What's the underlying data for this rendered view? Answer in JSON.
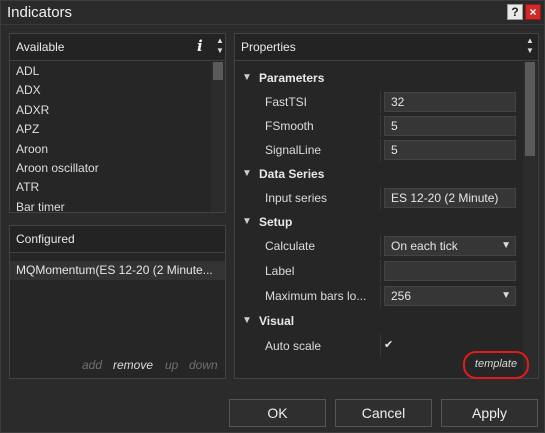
{
  "window": {
    "title": "Indicators",
    "help_label": "?",
    "close_label": "×"
  },
  "available": {
    "title": "Available",
    "info_label": "i",
    "items": [
      "ADL",
      "ADX",
      "ADXR",
      "APZ",
      "Aroon",
      "Aroon oscillator",
      "ATR",
      "Bar timer"
    ]
  },
  "configured": {
    "title": "Configured",
    "item": "MQMomentum(ES 12-20 (2 Minute...",
    "actions": {
      "add": "add",
      "remove": "remove",
      "up": "up",
      "down": "down"
    }
  },
  "properties": {
    "title": "Properties",
    "parameters": {
      "label": "Parameters",
      "fast_tsi": {
        "label": "FastTSI",
        "value": "32"
      },
      "fsmooth": {
        "label": "FSmooth",
        "value": "5"
      },
      "signal_line": {
        "label": "SignalLine",
        "value": "5"
      }
    },
    "data_series": {
      "label": "Data Series",
      "input_series": {
        "label": "Input series",
        "value": "ES 12-20 (2 Minute)"
      }
    },
    "setup": {
      "label": "Setup",
      "calculate": {
        "label": "Calculate",
        "value": "On each tick"
      },
      "label_field": {
        "label": "Label",
        "value": ""
      },
      "max_bars": {
        "label": "Maximum bars lo...",
        "value": "256"
      }
    },
    "visual": {
      "label": "Visual",
      "auto_scale": {
        "label": "Auto scale",
        "checked": true
      }
    },
    "template_label": "template"
  },
  "buttons": {
    "ok": "OK",
    "cancel": "Cancel",
    "apply": "Apply"
  },
  "colors": {
    "highlight_ring": "#e01c1c",
    "close_button": "#cf2a27"
  }
}
